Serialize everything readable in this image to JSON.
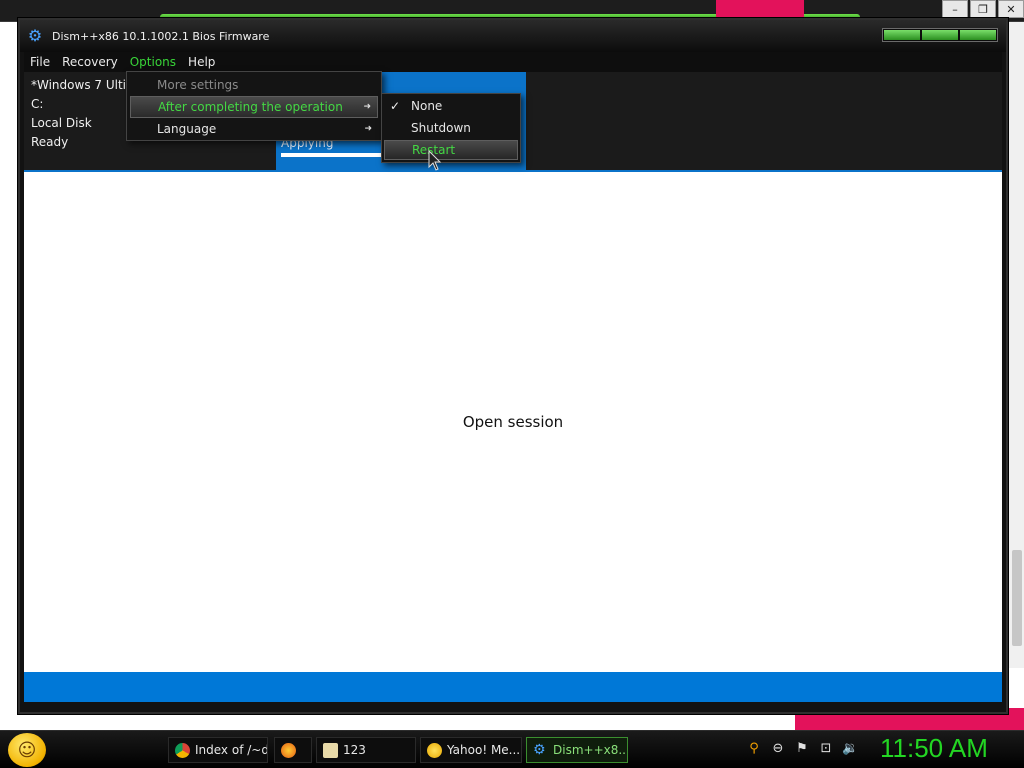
{
  "window": {
    "title": "Dism++x86 10.1.1002.1 Bios Firmware"
  },
  "menubar": {
    "file": "File",
    "recovery": "Recovery",
    "options": "Options",
    "help": "Help"
  },
  "session": {
    "os_name": "*Windows 7 Ultima",
    "drive": "C:",
    "disk_label": "Local Disk",
    "status": "Ready"
  },
  "progress": {
    "label": "Applying",
    "percent": 100
  },
  "options_menu": {
    "items": [
      {
        "label": "More settings",
        "disabled": true,
        "submenu": false
      },
      {
        "label": "After completing the operation",
        "submenu": true,
        "highlighted": true
      },
      {
        "label": "Language",
        "submenu": true
      }
    ]
  },
  "after_operation_submenu": {
    "items": [
      {
        "label": "None",
        "checked": true
      },
      {
        "label": "Shutdown",
        "checked": false
      },
      {
        "label": "Restart",
        "checked": false,
        "highlighted": true
      }
    ],
    "check_mark": "✓"
  },
  "main": {
    "placeholder_text": "Open session"
  },
  "taskbar": {
    "items": [
      {
        "label": "Index of /~d...",
        "icon": "chrome-icon"
      },
      {
        "label": "",
        "icon": "firefox-icon"
      },
      {
        "label": "123",
        "icon": "folder-icon"
      },
      {
        "label": "Yahoo! Me...",
        "icon": "yahoo-messenger-icon"
      },
      {
        "label": "Dism++x8...",
        "icon": "dism-gear-icon",
        "active": true
      }
    ],
    "clock": "11:50 AM"
  },
  "colors": {
    "accent_blue": "#0b73c9",
    "menu_highlight_green": "#44d844",
    "clock_green": "#23d623"
  }
}
